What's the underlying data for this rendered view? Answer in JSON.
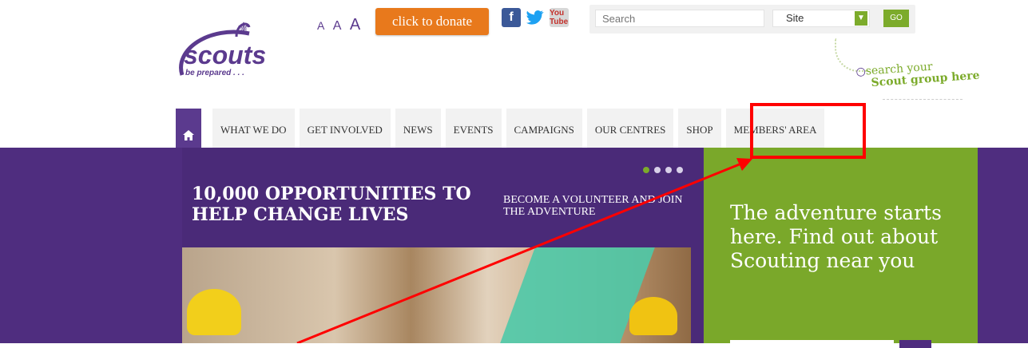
{
  "header": {
    "logo": {
      "word": "scouts",
      "tagline": "be prepared . . ."
    },
    "text_size": [
      "A",
      "A",
      "A"
    ],
    "donate_label": "click to donate",
    "social": [
      {
        "name": "facebook-icon",
        "glyph": "f"
      },
      {
        "name": "twitter-icon",
        "glyph": "t"
      },
      {
        "name": "youtube-icon",
        "glyph": "You Tube"
      }
    ],
    "search": {
      "placeholder": "Search",
      "scope_value": "Site",
      "go_label": "GO"
    },
    "hint": {
      "line1": "search your",
      "line2": "Scout group here"
    }
  },
  "nav": {
    "items": [
      "WHAT WE DO",
      "GET INVOLVED",
      "NEWS",
      "EVENTS",
      "CAMPAIGNS",
      "OUR CENTRES",
      "SHOP",
      "MEMBERS' AREA"
    ]
  },
  "hero": {
    "headline": "10,000 OPPORTUNITIES TO HELP CHANGE LIVES",
    "subline": "BECOME A VOLUNTEER AND JOIN THE ADVENTURE",
    "slides_total": 4,
    "slide_active": 1,
    "panel_text": "The adventure starts here. Find out about Scouting near you"
  },
  "colors": {
    "purple": "#4f2d7f",
    "green": "#7aa82a",
    "orange": "#e8791c",
    "annotation": "#ff0000"
  }
}
